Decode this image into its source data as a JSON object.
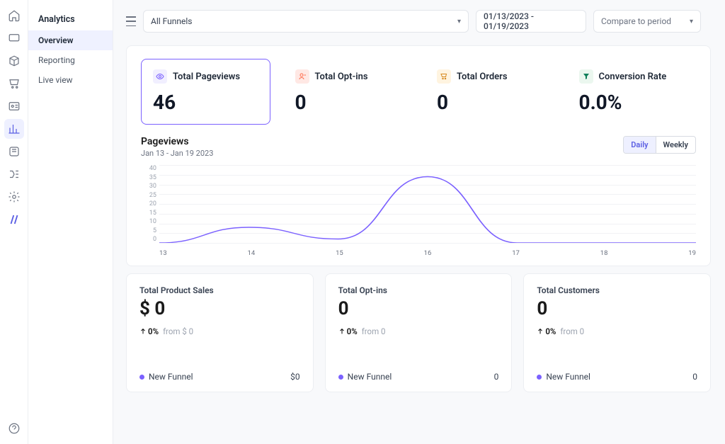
{
  "sidebar": {
    "heading": "Analytics",
    "items": [
      {
        "label": "Overview",
        "active": true
      },
      {
        "label": "Reporting",
        "active": false
      },
      {
        "label": "Live view",
        "active": false
      }
    ]
  },
  "topbar": {
    "funnel_selector": "All Funnels",
    "date_range": "01/13/2023 - 01/19/2023",
    "compare": "Compare to period"
  },
  "stats": [
    {
      "icon": "eye",
      "label": "Total Pageviews",
      "value": "46",
      "active": true
    },
    {
      "icon": "user",
      "label": "Total Opt-ins",
      "value": "0",
      "active": false
    },
    {
      "icon": "cart",
      "label": "Total Orders",
      "value": "0",
      "active": false
    },
    {
      "icon": "funnel",
      "label": "Conversion Rate",
      "value": "0.0%",
      "active": false
    }
  ],
  "chart": {
    "title": "Pageviews",
    "subtitle": "Jan 13 - Jan 19 2023",
    "toggle": {
      "daily": "Daily",
      "weekly": "Weekly"
    }
  },
  "chart_data": {
    "type": "line",
    "title": "Pageviews",
    "xlabel": "",
    "ylabel": "",
    "ylim": [
      0,
      40
    ],
    "y_ticks": [
      40,
      35,
      30,
      25,
      20,
      15,
      10,
      5,
      0
    ],
    "categories": [
      "13",
      "14",
      "15",
      "16",
      "17",
      "18",
      "19"
    ],
    "values": [
      0,
      8,
      2,
      34,
      0,
      0,
      0
    ]
  },
  "cards": [
    {
      "title": "Total Product Sales",
      "value": "$ 0",
      "pct": "0%",
      "from": "from $ 0",
      "funnel": "New Funnel",
      "fval": "$0"
    },
    {
      "title": "Total Opt-ins",
      "value": "0",
      "pct": "0%",
      "from": "from 0",
      "funnel": "New Funnel",
      "fval": "0"
    },
    {
      "title": "Total Customers",
      "value": "0",
      "pct": "0%",
      "from": "from 0",
      "funnel": "New Funnel",
      "fval": "0"
    }
  ]
}
